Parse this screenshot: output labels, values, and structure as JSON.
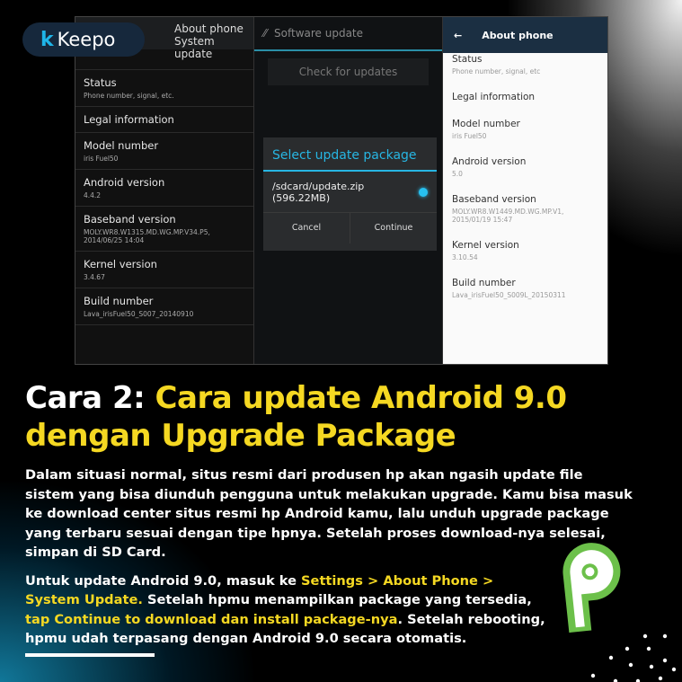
{
  "brand": {
    "logo": "Keepo"
  },
  "screenshot": {
    "left_panel": {
      "header": "About phone",
      "sub": "System update",
      "items": [
        {
          "title": "Status",
          "sub": "Phone number, signal, etc."
        },
        {
          "title": "Legal information",
          "sub": ""
        },
        {
          "title": "Model number",
          "sub": "iris Fuel50"
        },
        {
          "title": "Android version",
          "sub": "4.4.2"
        },
        {
          "title": "Baseband version",
          "sub": "MOLY.WR8.W1315.MD.WG.MP.V34.P5, 2014/06/25 14:04"
        },
        {
          "title": "Kernel version",
          "sub": "3.4.67"
        },
        {
          "title": "Build number",
          "sub": "Lava_irisFuel50_S007_20140910"
        }
      ]
    },
    "middle_panel": {
      "header": "Software update",
      "check_button": "Check for updates",
      "dialog": {
        "title": "Select update package",
        "file": "/sdcard/update.zip",
        "size": "(596.22MB)",
        "cancel": "Cancel",
        "continue": "Continue"
      }
    },
    "right_panel": {
      "header": "About phone",
      "items": [
        {
          "title": "Status",
          "sub": "Phone number, signal, etc"
        },
        {
          "title": "Legal information",
          "sub": ""
        },
        {
          "title": "Model number",
          "sub": "iris Fuel50"
        },
        {
          "title": "Android version",
          "sub": "5.0"
        },
        {
          "title": "Baseband version",
          "sub": "MOLY.WR8.W1449.MD.WG.MP.V1, 2015/01/19 15:47"
        },
        {
          "title": "Kernel version",
          "sub": "3.10.54"
        },
        {
          "title": "Build number",
          "sub": "Lava_irisFuel50_S009L_20150311"
        }
      ]
    }
  },
  "title": {
    "prefix": "Cara 2:",
    "main": "Cara update Android 9.0 dengan Upgrade Package"
  },
  "body": {
    "p1": "Dalam situasi normal, situs resmi dari produsen hp akan ngasih update file sistem yang bisa diunduh pengguna untuk melakukan upgrade. Kamu bisa masuk ke download center situs resmi hp Android kamu, lalu unduh upgrade package yang terbaru sesuai dengan tipe hpnya. Setelah proses download-nya selesai, simpan di SD Card.",
    "p2": [
      {
        "text": "Untuk update Android 9.0, masuk ke ",
        "hl": false
      },
      {
        "text": "Settings > About Phone > System Update.",
        "hl": true
      },
      {
        "text": " Setelah hpmu menampilkan package yang tersedia, ",
        "hl": false
      },
      {
        "text": "tap Continue to download dan install package-nya",
        "hl": true
      },
      {
        "text": ". Setelah rebooting, hpmu udah terpasang dengan Android 9.0 secara otomatis.",
        "hl": false
      }
    ]
  },
  "colors": {
    "highlight": "#f5d822",
    "brand": "#1fb5e8",
    "android_green": "#6cc04a"
  },
  "icons": {
    "android_pie": "android-pie-logo"
  }
}
